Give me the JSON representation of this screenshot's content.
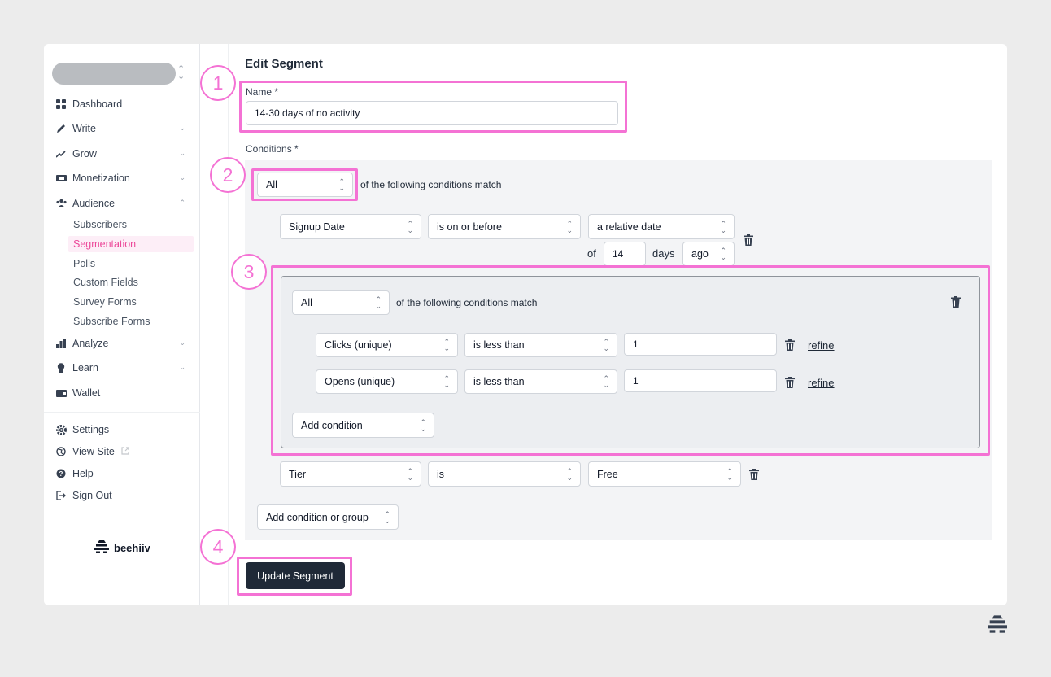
{
  "sidebar": {
    "nav": [
      {
        "label": "Dashboard",
        "icon": "dashboard-icon"
      },
      {
        "label": "Write",
        "icon": "pen-icon"
      },
      {
        "label": "Grow",
        "icon": "trend-icon"
      },
      {
        "label": "Monetization",
        "icon": "money-icon"
      },
      {
        "label": "Audience",
        "icon": "people-icon"
      }
    ],
    "audience_items": [
      "Subscribers",
      "Segmentation",
      "Polls",
      "Custom Fields",
      "Survey Forms",
      "Subscribe Forms"
    ],
    "nav2": [
      {
        "label": "Analyze",
        "icon": "bar-chart-icon"
      },
      {
        "label": "Learn",
        "icon": "bulb-icon"
      },
      {
        "label": "Wallet",
        "icon": "wallet-icon"
      }
    ],
    "bottom": [
      {
        "label": "Settings",
        "icon": "gear-icon"
      },
      {
        "label": "View Site",
        "icon": "globe-icon"
      },
      {
        "label": "Help",
        "icon": "help-icon"
      },
      {
        "label": "Sign Out",
        "icon": "sign-out-icon"
      }
    ],
    "brand": "beehiiv"
  },
  "form": {
    "title": "Edit Segment",
    "name_label": "Name *",
    "name_value": "14-30 days of no activity",
    "conditions_label": "Conditions *",
    "match": "All",
    "match_text": "of the following conditions match",
    "signup": {
      "field": "Signup Date",
      "operator": "is on or before",
      "value": "a relative date",
      "of": "of",
      "amount": "14",
      "unit": "days",
      "direction": "ago"
    },
    "group": {
      "match": "All",
      "match_text": "of the following conditions match",
      "rows": [
        {
          "field": "Clicks (unique)",
          "operator": "is less than",
          "value": "1",
          "refine": "refine"
        },
        {
          "field": "Opens (unique)",
          "operator": "is less than",
          "value": "1",
          "refine": "refine"
        }
      ],
      "add_condition": "Add condition"
    },
    "tier": {
      "field": "Tier",
      "operator": "is",
      "value": "Free"
    },
    "add_condition_group": "Add condition or group",
    "submit": "Update Segment"
  },
  "badges": [
    "1",
    "2",
    "3",
    "4"
  ],
  "colors": {
    "highlight": "#f472d4",
    "active_nav": "#ec4899",
    "button": "#1f2937"
  }
}
